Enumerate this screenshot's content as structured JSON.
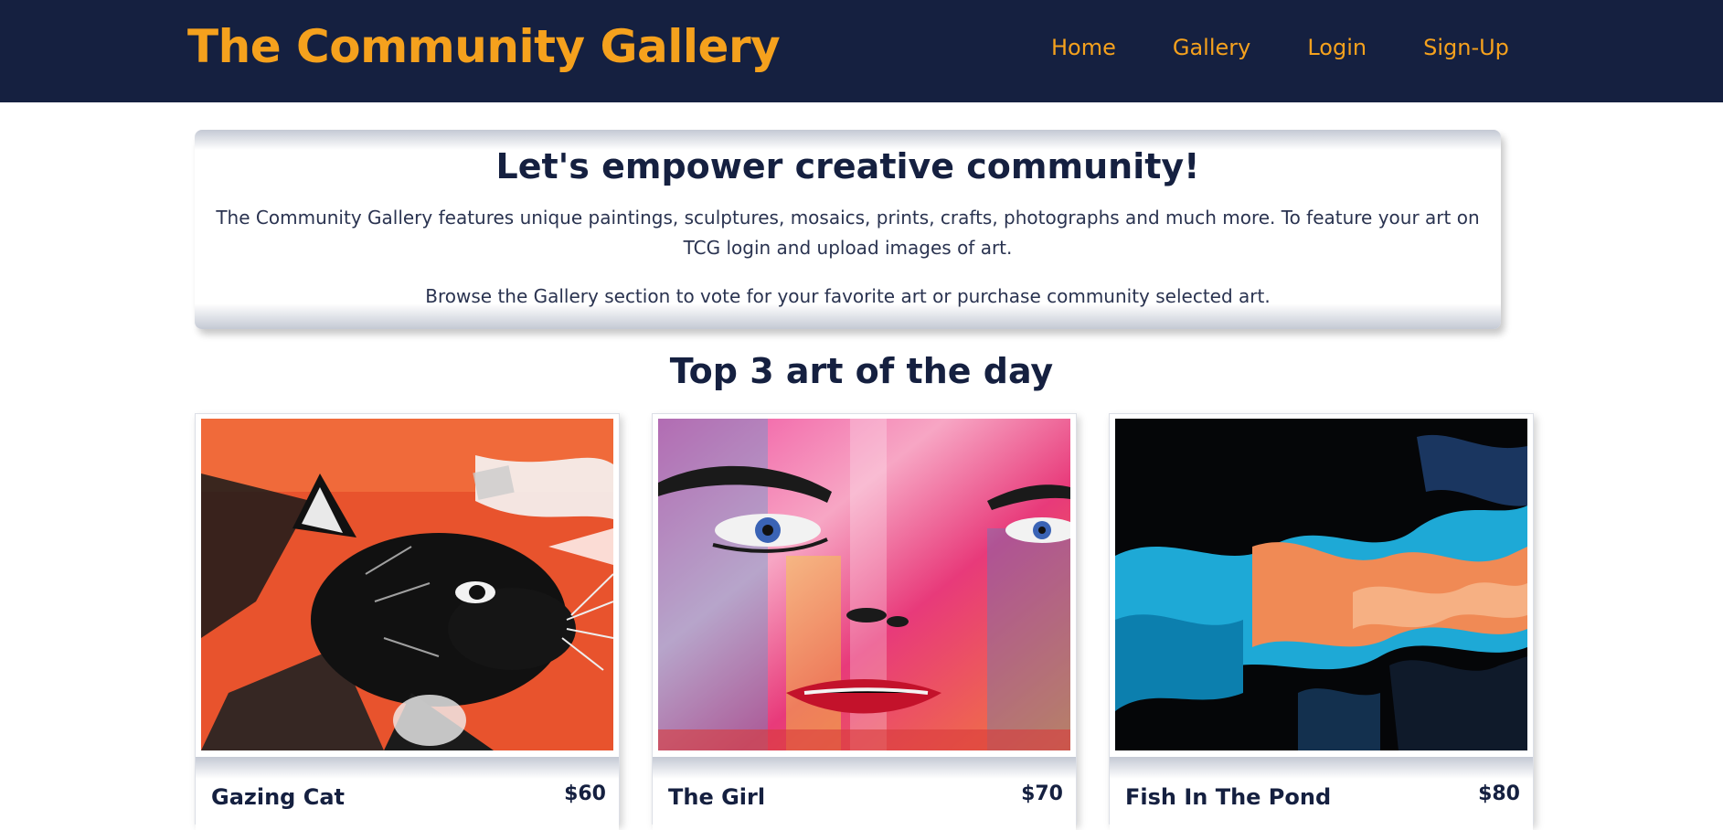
{
  "navbar": {
    "brand": "The Community Gallery",
    "links": [
      "Home",
      "Gallery",
      "Login",
      "Sign-Up"
    ]
  },
  "intro": {
    "title": "Let's empower creative community!",
    "paragraph1": "The Community Gallery features unique paintings, sculptures, mosaics, prints, crafts, photographs and much more. To feature your art on TCG login and upload images of art.",
    "paragraph2": "Browse the Gallery section to vote for your favorite art or purchase community selected art."
  },
  "top_art": {
    "title": "Top 3 art of the day",
    "items": [
      {
        "title": "Gazing Cat",
        "price": "$60"
      },
      {
        "title": "The Girl",
        "price": "$70"
      },
      {
        "title": "Fish In The Pond",
        "price": "$80"
      }
    ]
  },
  "colors": {
    "navbar_bg": "#152040",
    "accent": "#f5a11d",
    "text_dark": "#152040"
  }
}
